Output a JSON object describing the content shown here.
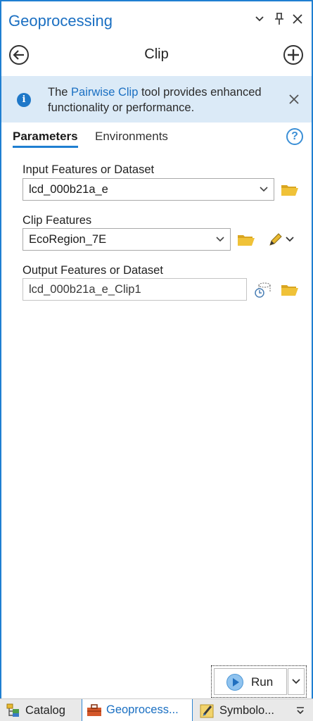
{
  "pane": {
    "title": "Geoprocessing",
    "tool_name": "Clip"
  },
  "banner": {
    "text_before": "The ",
    "link": "Pairwise Clip",
    "text_after": " tool provides enhanced functionality or performance."
  },
  "tabs": {
    "parameters": "Parameters",
    "environments": "Environments",
    "help": "?"
  },
  "params": {
    "input_label": "Input Features or Dataset",
    "input_value": "lcd_000b21a_e",
    "clip_label": "Clip Features",
    "clip_value": "EcoRegion_7E",
    "output_label": "Output Features or Dataset",
    "output_value": "lcd_000b21a_e_Clip1"
  },
  "run": {
    "label": "Run"
  },
  "dock": {
    "catalog": "Catalog",
    "geoprocessing": "Geoprocess...",
    "symbology": "Symbolo..."
  },
  "colors": {
    "accent": "#1f7fd1",
    "banner_bg": "#dbeaf7",
    "folder": "#e8b931"
  }
}
